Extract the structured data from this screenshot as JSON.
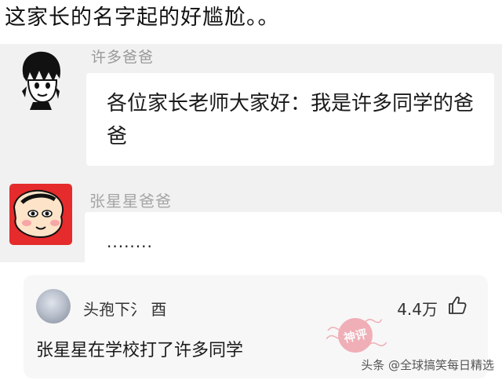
{
  "post": {
    "title": "这家长的名字起的好尴尬。。"
  },
  "chat": {
    "message1": {
      "sender": "许多爸爸",
      "text": "各位家长老师大家好：我是许多同学的爸爸"
    },
    "message2": {
      "sender": "张星星爸爸",
      "text": "........"
    }
  },
  "comment": {
    "username": "头孢下氵 酉",
    "likes": "4.4万",
    "text": "张星星在学校打了许多同学",
    "stamp_text": "神评",
    "icons": {
      "like": "thumbs-up-icon"
    }
  },
  "watermark": "头条 @全球搞笑每日精选",
  "colors": {
    "chat_background": "#f1f1f1",
    "bubble": "#ffffff",
    "avatar2_red": "#e52b2b",
    "stamp_red": "#e8586a",
    "card": "#f7f7f7"
  }
}
